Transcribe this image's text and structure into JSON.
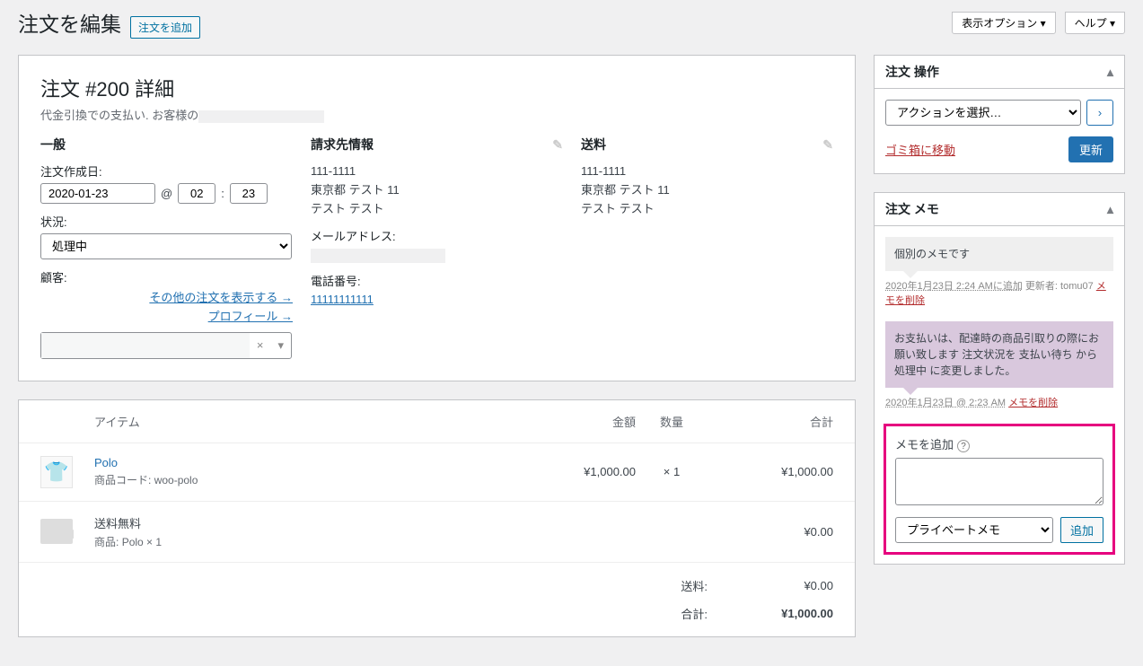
{
  "header": {
    "title": "注文を編集",
    "add_button": "注文を追加",
    "screen_options": "表示オプション",
    "help": "ヘルプ"
  },
  "order": {
    "title": "注文 #200 詳細",
    "subtitle": "代金引換での支払い. お客様の"
  },
  "general": {
    "heading": "一般",
    "date_label": "注文作成日:",
    "date": "2020-01-23",
    "at": "@",
    "hour": "02",
    "colon": ":",
    "minute": "23",
    "status_label": "状況:",
    "status": "処理中",
    "customer_label": "顧客:",
    "other_orders_link": "その他の注文を表示する →",
    "profile_link": "プロフィール →",
    "customer_clear": "×"
  },
  "billing": {
    "heading": "請求先情報",
    "zip": "111-1111",
    "line1": "東京都 テスト 11",
    "line2": "テスト テスト",
    "email_label": "メールアドレス:",
    "phone_label": "電話番号:",
    "phone": "11111111111"
  },
  "shipping": {
    "heading": "送料",
    "zip": "111-1111",
    "line1": "東京都 テスト 11",
    "line2": "テスト テスト"
  },
  "items": {
    "col_item": "アイテム",
    "col_amount": "金額",
    "col_qty": "数量",
    "col_total": "合計",
    "product": {
      "name": "Polo",
      "sku_label": "商品コード:",
      "sku": "woo-polo",
      "amount": "¥1,000.00",
      "qty_prefix": "×",
      "qty": "1",
      "total": "¥1,000.00"
    },
    "ship_row": {
      "name": "送料無料",
      "detail_label": "商品:",
      "detail": "Polo × 1",
      "total": "¥0.00"
    },
    "totals": {
      "ship_label": "送料:",
      "ship_value": "¥0.00",
      "total_label": "合計:",
      "total_value": "¥1,000.00"
    }
  },
  "actions": {
    "heading": "注文 操作",
    "select_placeholder": "アクションを選択…",
    "run": "›",
    "trash": "ゴミ箱に移動",
    "update": "更新"
  },
  "notes": {
    "heading": "注文 メモ",
    "n1": {
      "text": "個別のメモです",
      "meta_date": "2020年1月23日 2:24 AMに追加",
      "meta_author": "更新者: tomu07",
      "delete": "メモを削除"
    },
    "n2": {
      "text": "お支払いは、配達時の商品引取りの際にお願い致します 注文状況を 支払い待ち から 処理中 に変更しました。",
      "meta_date": "2020年1月23日 @ 2:23 AM",
      "delete": "メモを削除"
    },
    "add_label": "メモを追加",
    "type": "プライベートメモ",
    "add_btn": "追加"
  }
}
